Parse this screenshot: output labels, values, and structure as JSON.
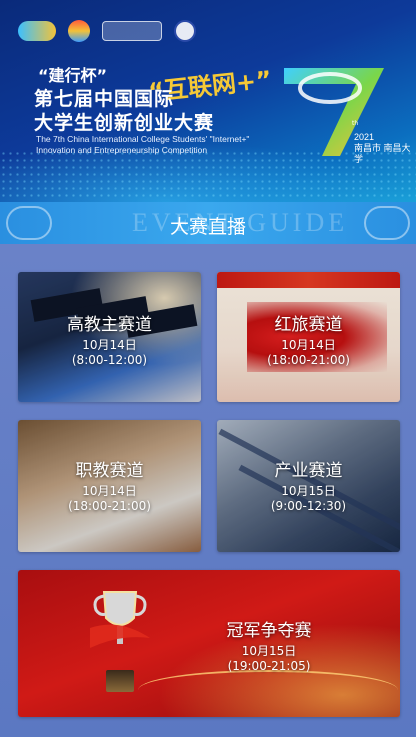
{
  "banner": {
    "cup_name": "“建行杯”",
    "title_line1": "第七届中国国际",
    "title_line2": "大学生创新创业大赛",
    "internet_plus": "“互联网+”",
    "subtitle_en_line1": "The 7th China International College Students' \"Internet+\"",
    "subtitle_en_line2": "Innovation and Entrepreneurship Competition",
    "ordinal_suffix": "th",
    "year": "2021",
    "host": "南昌市 南昌大学"
  },
  "live": {
    "title": "大赛直播",
    "ghost_text": "EVENT GUIDE"
  },
  "tracks": [
    {
      "name": "高教主赛道",
      "date": "10月14日",
      "time": "(8:00-12:00)"
    },
    {
      "name": "红旅赛道",
      "date": "10月14日",
      "time": "(18:00-21:00)"
    },
    {
      "name": "职教赛道",
      "date": "10月14日",
      "time": "(18:00-21:00)"
    },
    {
      "name": "产业赛道",
      "date": "10月15日",
      "time": "(9:00-12:30)"
    },
    {
      "name": "冠军争夺赛",
      "date": "10月15日",
      "time": "(19:00-21:05)"
    }
  ],
  "colors": {
    "banner_dark": "#0a2a7a",
    "live_bar": "#3aa8ee",
    "background": "#5b78c2",
    "accent_gold": "#f6c936",
    "final_red": "#d01a16"
  }
}
